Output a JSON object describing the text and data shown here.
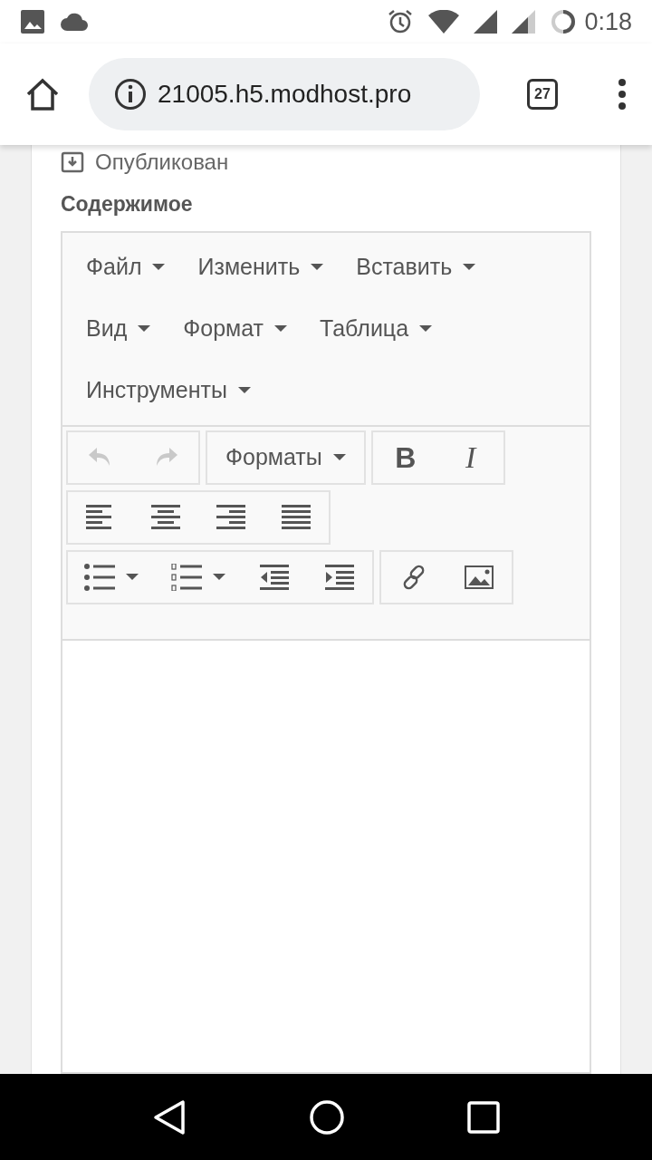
{
  "status_bar": {
    "time": "0:18"
  },
  "browser": {
    "url": "21005.h5.modhost.pro",
    "tab_count": "27"
  },
  "published": {
    "label": "Опубликован"
  },
  "content_label": "Содержимое",
  "menu": [
    {
      "label": "Файл"
    },
    {
      "label": "Изменить"
    },
    {
      "label": "Вставить"
    },
    {
      "label": "Вид"
    },
    {
      "label": "Формат"
    },
    {
      "label": "Таблица"
    },
    {
      "label": "Инструменты"
    }
  ],
  "toolbar": [
    [
      {
        "kind": "undo",
        "disabled": true
      },
      {
        "kind": "redo",
        "disabled": true
      }
    ],
    [
      {
        "kind": "formats",
        "label": "Форматы",
        "disabled": false
      }
    ],
    [
      {
        "kind": "bold",
        "label": "B",
        "disabled": false
      },
      {
        "kind": "italic",
        "label": "I",
        "disabled": false
      }
    ],
    [
      {
        "kind": "align-left",
        "disabled": false
      },
      {
        "kind": "align-center",
        "disabled": false
      },
      {
        "kind": "align-right",
        "disabled": false
      },
      {
        "kind": "align-justify",
        "disabled": false
      }
    ],
    [
      {
        "kind": "bullet-list",
        "disabled": false
      },
      {
        "kind": "numbered-list",
        "disabled": false
      },
      {
        "kind": "outdent",
        "disabled": false
      },
      {
        "kind": "indent",
        "disabled": false
      }
    ],
    [
      {
        "kind": "link",
        "disabled": false
      },
      {
        "kind": "image",
        "disabled": false
      }
    ]
  ]
}
